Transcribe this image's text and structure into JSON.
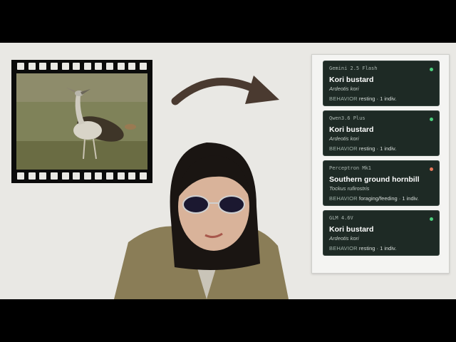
{
  "cards": [
    {
      "model": "Gemini 2.5 Flash",
      "species": "Kori bustard",
      "scientific": "Ardeotis kori",
      "behavior_label": "BEHAVIOR",
      "behavior": "resting · 1 indiv.",
      "status_color": "#4cd07d"
    },
    {
      "model": "Qwen3.6 Plus",
      "species": "Kori bustard",
      "scientific": "Ardeotis kori",
      "behavior_label": "BEHAVIOR",
      "behavior": "resting · 1 indiv.",
      "status_color": "#4cd07d"
    },
    {
      "model": "Perceptron Mk1",
      "species": "Southern ground hornbill",
      "scientific": "Tockus rufirostris",
      "behavior_label": "BEHAVIOR",
      "behavior": "foraging/feeding · 1 indiv.",
      "status_color": "#e8795a"
    },
    {
      "model": "GLM 4.6V",
      "species": "Kori bustard",
      "scientific": "Ardeotis kori",
      "behavior_label": "BEHAVIOR",
      "behavior": "resting · 1 indiv.",
      "status_color": "#4cd07d"
    }
  ],
  "icons": {
    "film": "film-strip-icon",
    "arrow": "curved-arrow-icon"
  }
}
